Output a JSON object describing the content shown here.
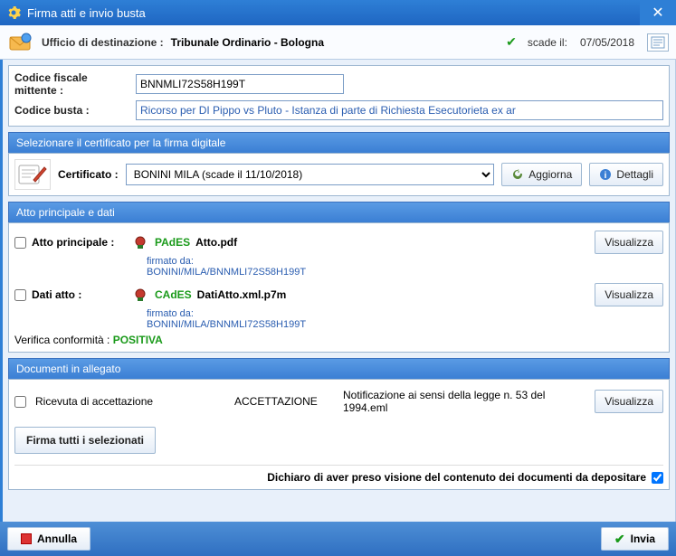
{
  "window": {
    "title": "Firma atti e invio busta"
  },
  "dest": {
    "label": "Ufficio di destinazione :",
    "value": "Tribunale Ordinario - Bologna",
    "deadline_label": "scade il:",
    "deadline_value": "07/05/2018"
  },
  "sender": {
    "cf_label": "Codice fiscale mittente :",
    "cf_value": "BNNMLI72S58H199T",
    "bcode_label": "Codice  busta :",
    "bcode_value": "Ricorso per DI Pippo vs Pluto - Istanza di parte di Richiesta Esecutorieta ex ar"
  },
  "cert": {
    "section_title": "Selezionare il certificato per la firma digitale",
    "label": "Certificato :",
    "value": "BONINI MILA (scade il 11/10/2018)",
    "refresh_label": "Aggiorna",
    "details_label": "Dettagli"
  },
  "main_doc": {
    "section_title": "Atto principale e dati",
    "principal_label": "Atto principale :",
    "principal_tag": "PAdES",
    "principal_file": "Atto.pdf",
    "data_label": "Dati atto :",
    "data_tag": "CAdES",
    "data_file": "DatiAtto.xml.p7m",
    "signed_by_label": "firmato da:",
    "signed_by_value": "BONINI/MILA/BNNMLI72S58H199T",
    "verify_label": "Verifica conformità :",
    "verify_value": "POSITIVA",
    "view_label": "Visualizza"
  },
  "attachments": {
    "section_title": "Documenti in allegato",
    "items": [
      {
        "name": "Ricevuta di accettazione",
        "type": "ACCETTAZIONE",
        "desc": "Notificazione ai sensi della legge n. 53 del 1994.eml"
      }
    ],
    "view_label": "Visualizza"
  },
  "actions": {
    "sign_all_label": "Firma tutti i selezionati",
    "declare_label": "Dichiaro di aver preso visione del contenuto dei documenti da depositare"
  },
  "footer": {
    "cancel": "Annulla",
    "send": "Invia"
  }
}
